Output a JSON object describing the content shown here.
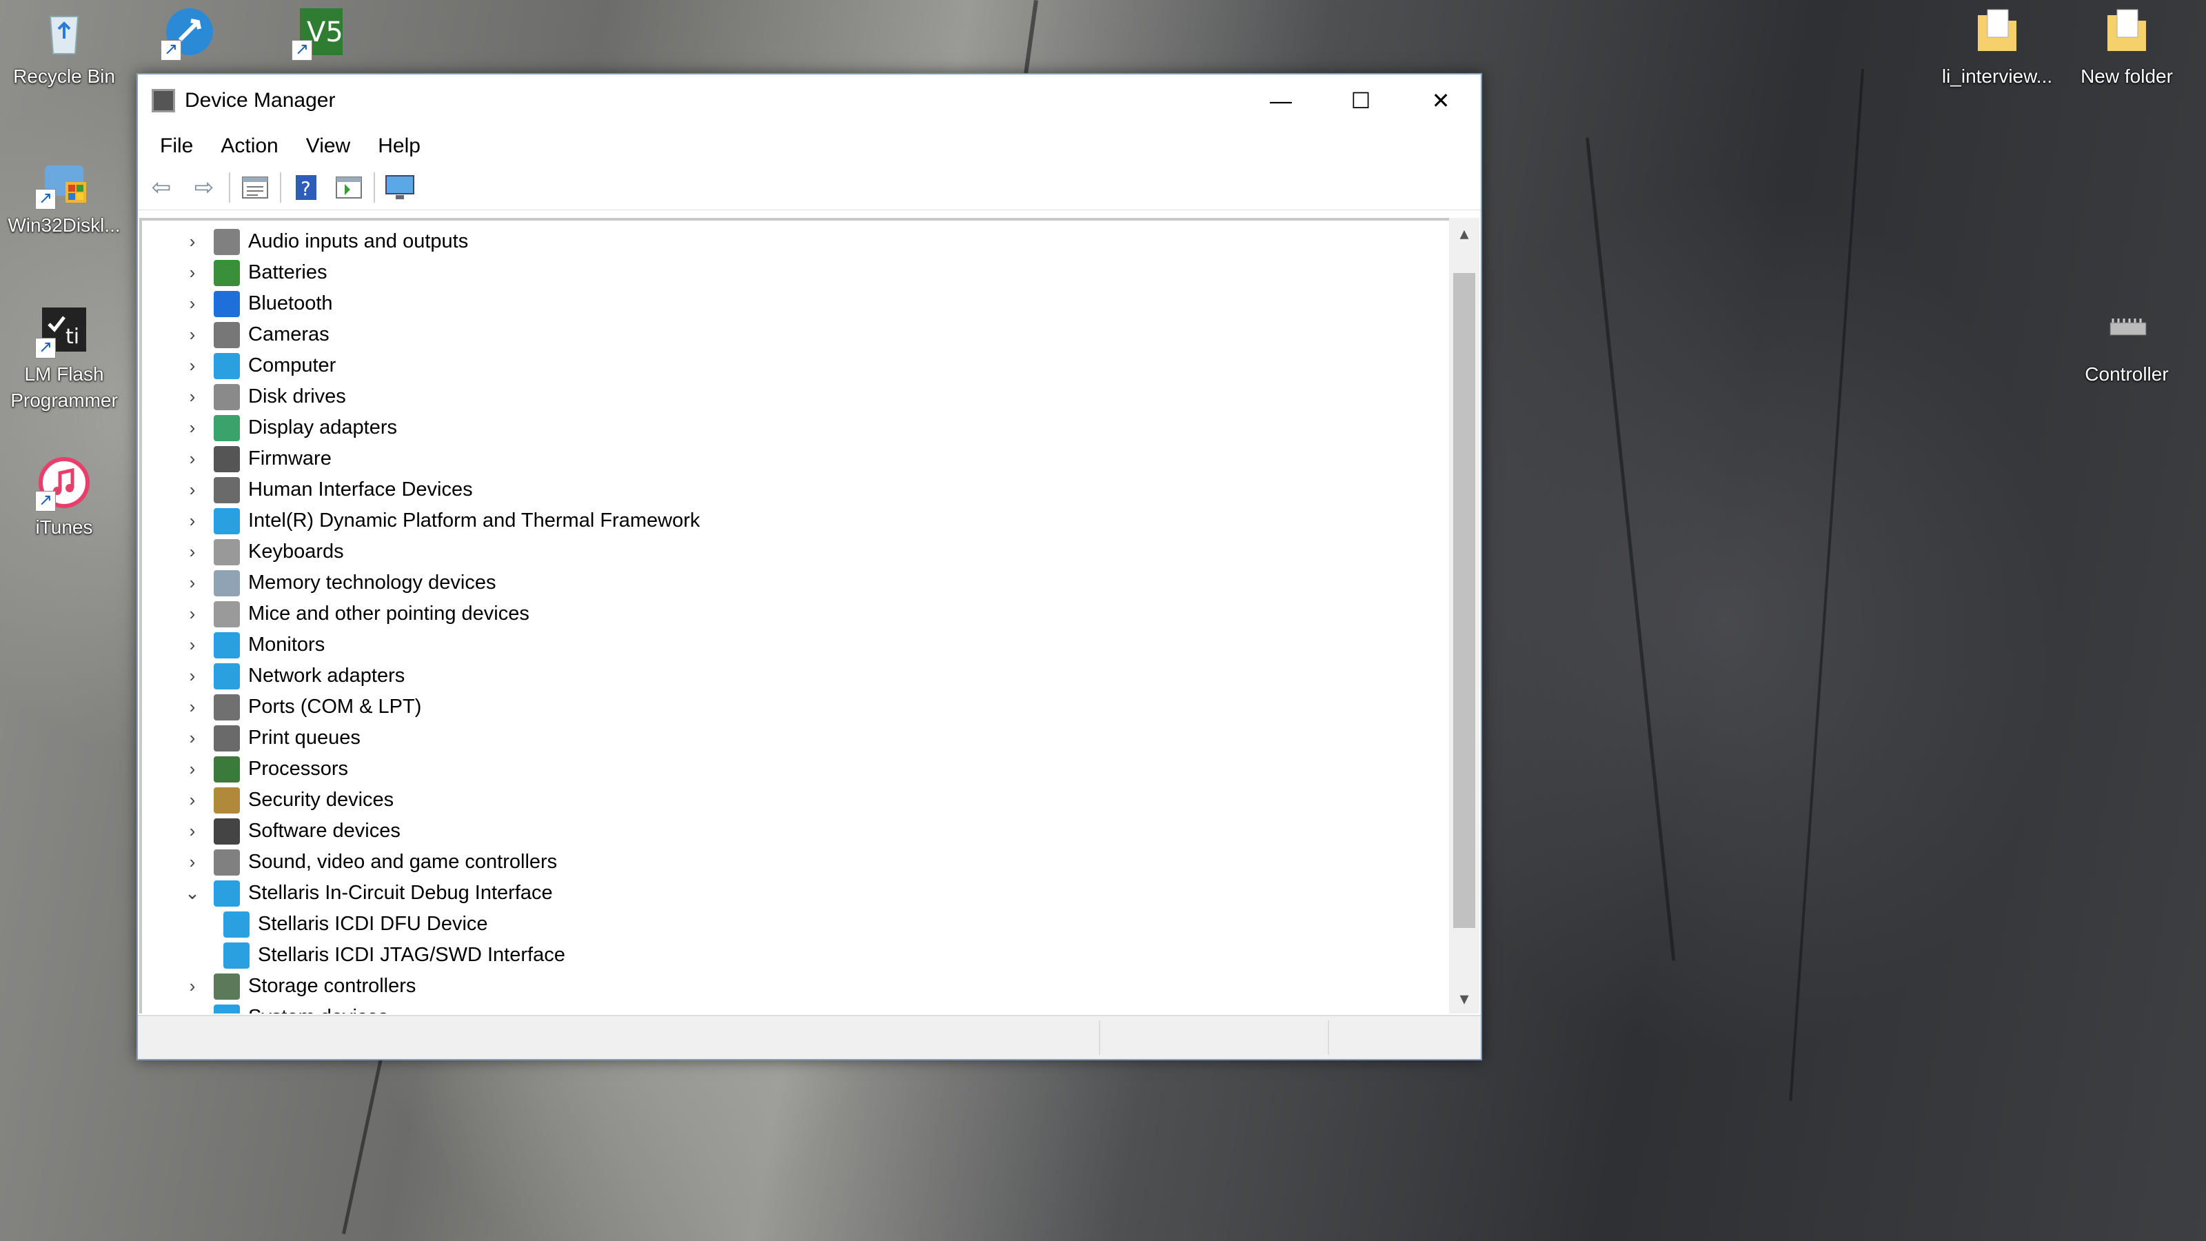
{
  "desktop": {
    "left_icons": [
      {
        "label": "Recycle Bin",
        "icon": "recycle-bin-icon"
      },
      {
        "label": "Win32Diskl...",
        "icon": "disk-imager-icon"
      },
      {
        "label": "LM Flash Programmer",
        "icon": "flash-programmer-icon"
      },
      {
        "label": "iTunes",
        "icon": "itunes-icon"
      }
    ],
    "right_icons": [
      {
        "label": "li_interview...",
        "icon": "folder-icon"
      },
      {
        "label": "New folder",
        "icon": "folder-icon"
      },
      {
        "label": "Controller",
        "icon": "chip-icon"
      }
    ]
  },
  "window": {
    "title": "Device Manager",
    "controls": {
      "minimize": "—",
      "maximize": "☐",
      "close": "✕"
    },
    "menu": [
      "File",
      "Action",
      "View",
      "Help"
    ],
    "toolbar": [
      "back-arrow-icon",
      "forward-arrow-icon",
      "properties-icon",
      "help-icon",
      "view-icon",
      "monitor-icon"
    ]
  },
  "tree": {
    "items": [
      {
        "label": "Audio inputs and outputs",
        "icon": "speaker-icon",
        "color": "#808080",
        "expanded": false,
        "level": 0
      },
      {
        "label": "Batteries",
        "icon": "battery-icon",
        "color": "#3a8f3a",
        "expanded": false,
        "level": 0
      },
      {
        "label": "Bluetooth",
        "icon": "bluetooth-icon",
        "color": "#1e6fd9",
        "expanded": false,
        "level": 0
      },
      {
        "label": "Cameras",
        "icon": "camera-icon",
        "color": "#777777",
        "expanded": false,
        "level": 0
      },
      {
        "label": "Computer",
        "icon": "computer-icon",
        "color": "#2aa0e0",
        "expanded": false,
        "level": 0
      },
      {
        "label": "Disk drives",
        "icon": "disk-drive-icon",
        "color": "#8a8a8a",
        "expanded": false,
        "level": 0
      },
      {
        "label": "Display adapters",
        "icon": "display-adapter-icon",
        "color": "#3aa36b",
        "expanded": false,
        "level": 0
      },
      {
        "label": "Firmware",
        "icon": "firmware-icon",
        "color": "#555555",
        "expanded": false,
        "level": 0
      },
      {
        "label": "Human Interface Devices",
        "icon": "hid-icon",
        "color": "#6a6a6a",
        "expanded": false,
        "level": 0
      },
      {
        "label": "Intel(R) Dynamic Platform and Thermal Framework",
        "icon": "monitor-icon",
        "color": "#2aa0e0",
        "expanded": false,
        "level": 0
      },
      {
        "label": "Keyboards",
        "icon": "keyboard-icon",
        "color": "#999999",
        "expanded": false,
        "level": 0
      },
      {
        "label": "Memory technology devices",
        "icon": "memory-icon",
        "color": "#8fa3b5",
        "expanded": false,
        "level": 0
      },
      {
        "label": "Mice and other pointing devices",
        "icon": "mouse-icon",
        "color": "#9a9a9a",
        "expanded": false,
        "level": 0
      },
      {
        "label": "Monitors",
        "icon": "monitor-icon",
        "color": "#2aa0e0",
        "expanded": false,
        "level": 0
      },
      {
        "label": "Network adapters",
        "icon": "network-icon",
        "color": "#2aa0e0",
        "expanded": false,
        "level": 0
      },
      {
        "label": "Ports (COM & LPT)",
        "icon": "port-icon",
        "color": "#707070",
        "expanded": false,
        "level": 0
      },
      {
        "label": "Print queues",
        "icon": "printer-icon",
        "color": "#6a6a6a",
        "expanded": false,
        "level": 0
      },
      {
        "label": "Processors",
        "icon": "processor-icon",
        "color": "#3a7a3a",
        "expanded": false,
        "level": 0
      },
      {
        "label": "Security devices",
        "icon": "security-icon",
        "color": "#b08a3a",
        "expanded": false,
        "level": 0
      },
      {
        "label": "Software devices",
        "icon": "software-icon",
        "color": "#444444",
        "expanded": false,
        "level": 0
      },
      {
        "label": "Sound, video and game controllers",
        "icon": "speaker-icon",
        "color": "#808080",
        "expanded": false,
        "level": 0
      },
      {
        "label": "Stellaris In-Circuit Debug Interface",
        "icon": "network-icon",
        "color": "#2aa0e0",
        "expanded": true,
        "level": 0
      },
      {
        "label": "Stellaris ICDI DFU Device",
        "icon": "network-icon",
        "color": "#2aa0e0",
        "expanded": null,
        "level": 1
      },
      {
        "label": "Stellaris ICDI JTAG/SWD Interface",
        "icon": "network-icon",
        "color": "#2aa0e0",
        "expanded": null,
        "level": 1
      },
      {
        "label": "Storage controllers",
        "icon": "storage-icon",
        "color": "#5a7a5a",
        "expanded": false,
        "level": 0
      },
      {
        "label": "System devices",
        "icon": "system-icon",
        "color": "#2aa0e0",
        "expanded": false,
        "level": 0
      }
    ]
  }
}
